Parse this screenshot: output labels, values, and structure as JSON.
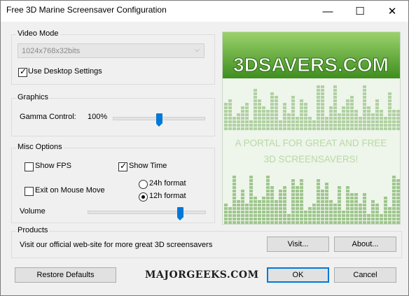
{
  "window": {
    "title": "Free 3D Marine Screensaver Configuration",
    "controls": {
      "minimize": "—",
      "maximize": "☐",
      "close": "✕"
    }
  },
  "video_mode": {
    "group_title": "Video Mode",
    "resolution_value": "1024x768x32bits",
    "use_desktop_label": "Use Desktop Settings",
    "use_desktop_checked": true
  },
  "graphics": {
    "group_title": "Graphics",
    "gamma_label": "Gamma Control:",
    "gamma_value": "100%",
    "gamma_level": 0.5
  },
  "misc": {
    "group_title": "Misc Options",
    "show_fps_label": "Show FPS",
    "show_fps_checked": false,
    "show_time_label": "Show Time",
    "show_time_checked": true,
    "exit_label": "Exit on Mouse Move",
    "exit_checked": false,
    "format_24_label": "24h format",
    "format_12_label": "12h format",
    "selected_format": "12h",
    "volume_label": "Volume",
    "volume_level": 0.78
  },
  "banner": {
    "logo_text": "3DSAVERS.COM",
    "tagline_line1": "A PORTAL FOR GREAT AND FREE",
    "tagline_line2": "3D SCREENSAVERS!",
    "colors": {
      "green_dark": "#3f8e1f",
      "green_light": "#9bd26b",
      "text": "#ffffff",
      "tagline": "#b8d9a6",
      "bg": "#eef5ea"
    }
  },
  "products": {
    "group_title": "Products",
    "description": "Visit our official web-site for more great 3D screensavers",
    "visit_label": "Visit...",
    "about_label": "About..."
  },
  "footer": {
    "restore_label": "Restore Defaults",
    "ok_label": "OK",
    "cancel_label": "Cancel"
  },
  "watermark": {
    "text": "MAJORGEEKS.COM"
  },
  "colors": {
    "accent": "#0078d7",
    "dialog_bg": "#f0f0f0"
  }
}
